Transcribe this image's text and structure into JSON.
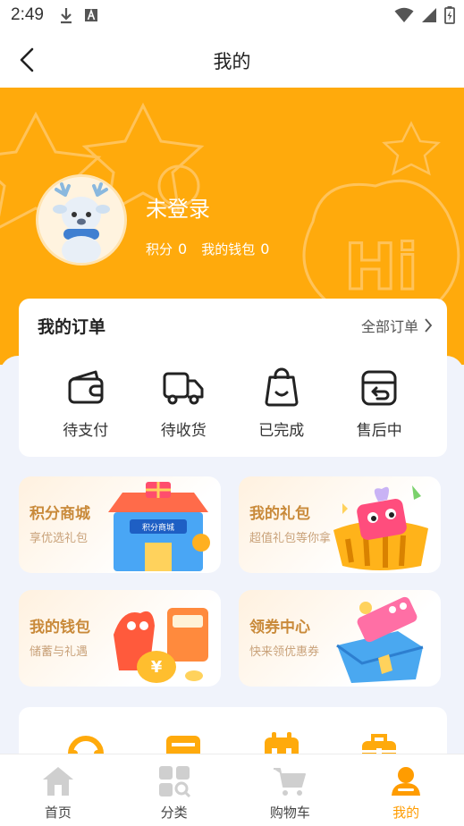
{
  "status_bar": {
    "time": "2:49"
  },
  "header": {
    "title": "我的"
  },
  "profile": {
    "login_text": "未登录",
    "points_label": "积分",
    "points_value": "0",
    "wallet_label": "我的钱包",
    "wallet_value": "0"
  },
  "orders": {
    "title": "我的订单",
    "all_label": "全部订单",
    "items": [
      {
        "label": "待支付",
        "icon": "wallet-icon"
      },
      {
        "label": "待收货",
        "icon": "truck-icon"
      },
      {
        "label": "已完成",
        "icon": "bag-icon"
      },
      {
        "label": "售后中",
        "icon": "return-box-icon"
      }
    ]
  },
  "promos": [
    {
      "title": "积分商城",
      "subtitle": "享优选礼包",
      "image_text": "积分商城"
    },
    {
      "title": "我的礼包",
      "subtitle": "超值礼包等你拿"
    },
    {
      "title": "我的钱包",
      "subtitle": "储蓄与礼遇"
    },
    {
      "title": "领券中心",
      "subtitle": "快来领优惠券"
    }
  ],
  "tabs": [
    {
      "label": "首页",
      "icon": "home-icon",
      "active": false
    },
    {
      "label": "分类",
      "icon": "category-icon",
      "active": false
    },
    {
      "label": "购物车",
      "icon": "cart-icon",
      "active": false
    },
    {
      "label": "我的",
      "icon": "user-icon",
      "active": true
    }
  ],
  "colors": {
    "accent": "#ffaa0c",
    "tab_active": "#ff9c00",
    "promo_title": "#c98a3a"
  }
}
